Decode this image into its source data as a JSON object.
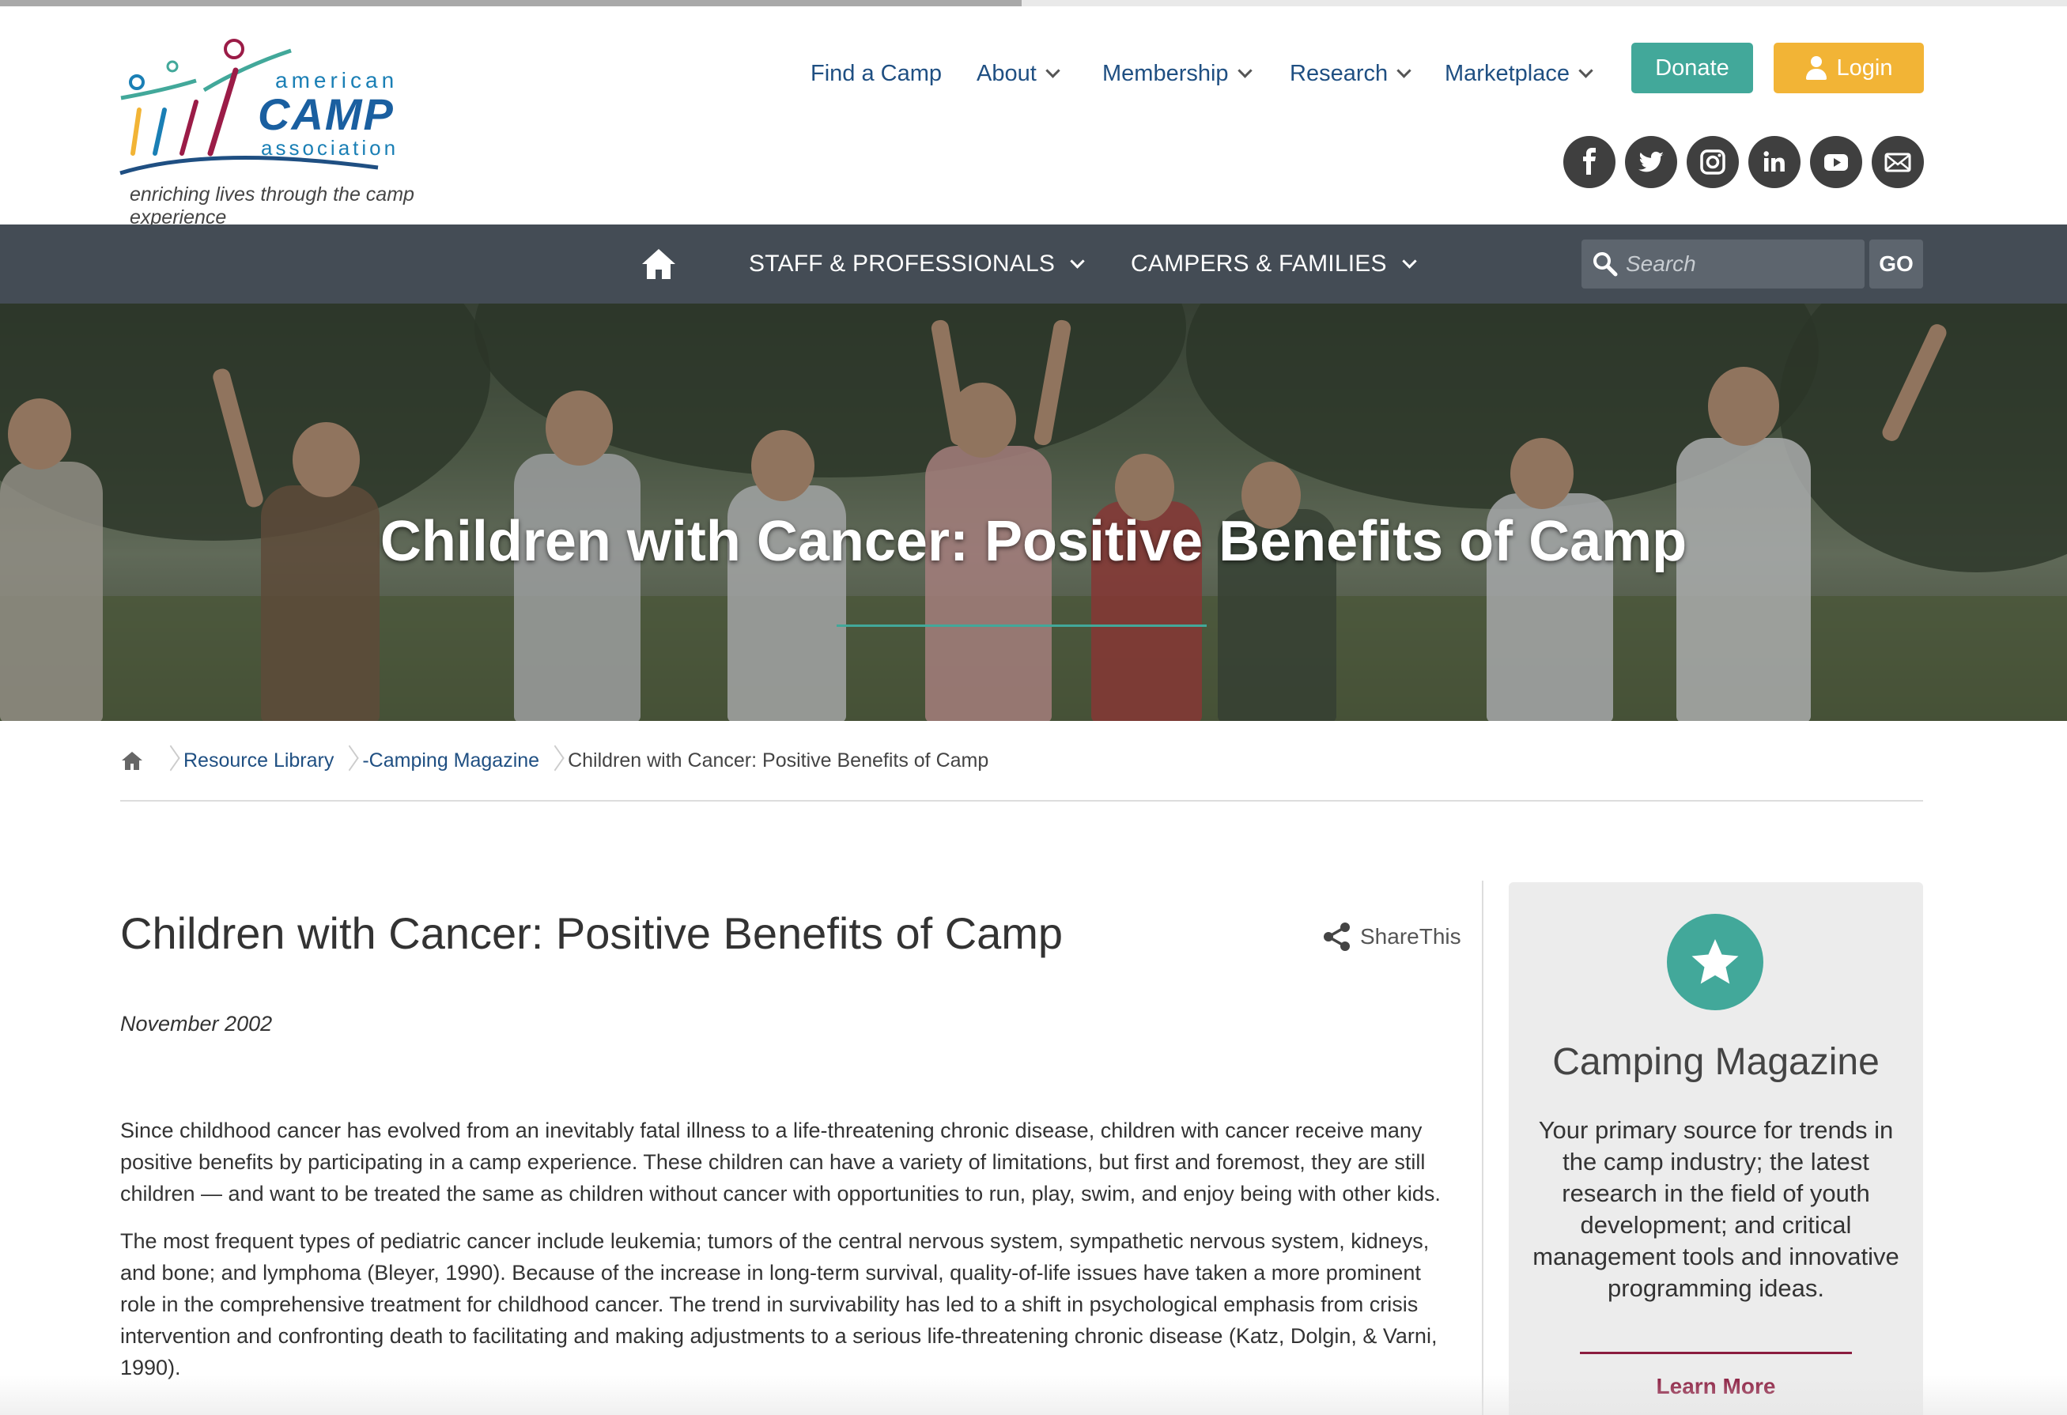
{
  "header": {
    "logo_text_top": "american",
    "logo_text_main": "CAMP",
    "logo_text_bottom": "association",
    "tagline": "enriching lives through the camp experience",
    "nav": [
      {
        "label": "Find a Camp",
        "dropdown": false
      },
      {
        "label": "About",
        "dropdown": true
      },
      {
        "label": "Membership",
        "dropdown": true
      },
      {
        "label": "Research",
        "dropdown": true
      },
      {
        "label": "Marketplace",
        "dropdown": true
      }
    ],
    "donate_label": "Donate",
    "login_label": "Login",
    "social": [
      "facebook-icon",
      "twitter-icon",
      "instagram-icon",
      "linkedin-icon",
      "youtube-icon",
      "email-icon"
    ]
  },
  "navbar": {
    "home_icon": "home-icon",
    "items": [
      {
        "label": "STAFF & PROFESSIONALS"
      },
      {
        "label": "CAMPERS & FAMILIES"
      }
    ],
    "search_placeholder": "Search",
    "go_label": "GO"
  },
  "hero": {
    "title": "Children with Cancer: Positive Benefits of Camp"
  },
  "breadcrumb": {
    "items": [
      "Resource Library",
      "-Camping Magazine"
    ],
    "current": "Children with Cancer: Positive Benefits of Camp"
  },
  "article": {
    "title": "Children with Cancer: Positive Benefits of Camp",
    "share_label": "ShareThis",
    "date": "November 2002",
    "paragraphs": [
      "Since childhood cancer has evolved from an inevitably fatal illness to a life-threatening chronic disease, children with cancer receive many positive benefits by participating in a camp experience. These children can have a variety of limitations, but first and foremost, they are still children — and want to be treated the same as children without cancer with opportunities to run, play, swim, and enjoy being with other kids.",
      "The most frequent types of pediatric cancer include leukemia; tumors of the central nervous system, sympathetic nervous system, kidneys, and bone; and lymphoma (Bleyer, 1990). Because of the increase in long-term survival, quality-of-life issues have taken a more prominent role in the comprehensive treatment for childhood cancer. The trend in survivability has led to a shift in psychological emphasis from crisis intervention and confronting death to facilitating and making adjustments to a serious life-threatening chronic disease (Katz, Dolgin, & Varni, 1990)."
    ]
  },
  "sidebar": {
    "icon": "star-icon",
    "title": "Camping Magazine",
    "description": "Your primary source for trends in the camp industry; the latest research in the field of youth development; and critical management tools and innovative programming ideas.",
    "link_label": "Learn More"
  },
  "colors": {
    "nav_text": "#1f4f82",
    "donate": "#42a89a",
    "login": "#f2b436",
    "navbar_bg": "#444c55",
    "accent_maroon": "#8b1c3f"
  }
}
